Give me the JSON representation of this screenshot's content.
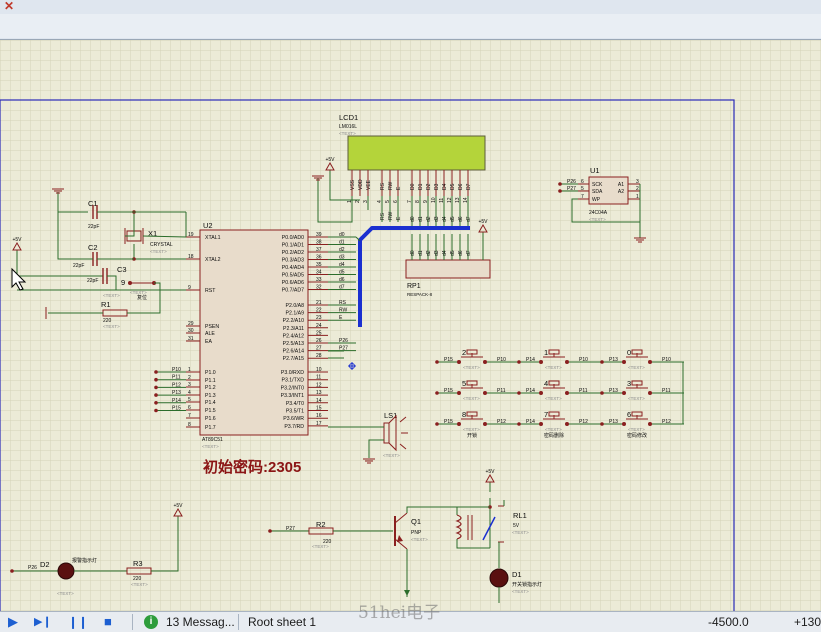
{
  "colors": {
    "canvas_bg": "#ecebd7",
    "grid": "#d5d3b8",
    "sheet_border": "#2a2ab8",
    "wire": "#2b6d2b",
    "component": "#8a1f1f",
    "chip_fill": "#e8dccb",
    "lcd_fill": "#b4d43a",
    "bus": "#1a2fd0",
    "label": "#0b0b0b",
    "text_placeholder": "#8c8c8c",
    "note_red": "#8b1515",
    "pin_dot": "#8a1f1f"
  },
  "icons": {
    "tab_close": "✕",
    "play": "▶",
    "step": "▶❙",
    "pause": "❙❙",
    "stop": "■",
    "message": "i"
  },
  "placeholder": "<TEXT>",
  "power": "+5V",
  "lcd": {
    "ref": "LCD1",
    "part": "LM016L",
    "pins_left": [
      "VSS",
      "VDD",
      "VEE"
    ],
    "pins_ctrl": [
      "RS",
      "RW",
      "E"
    ],
    "pins_data": [
      "D0",
      "D1",
      "D2",
      "D3",
      "D4",
      "D5",
      "D6",
      "D7"
    ],
    "pin_nums": [
      "1",
      "2",
      "3",
      "4",
      "5",
      "6",
      "7",
      "8",
      "9",
      "10",
      "11",
      "12",
      "13",
      "14"
    ]
  },
  "mcu": {
    "ref": "U2",
    "part": "AT89C51",
    "left_pins": [
      {
        "num": "19",
        "name": "XTAL1"
      },
      {
        "num": "18",
        "name": "XTAL2"
      },
      {
        "num": "9",
        "name": "RST"
      },
      {
        "num": "29",
        "name": "PSEN"
      },
      {
        "num": "30",
        "name": "ALE"
      },
      {
        "num": "31",
        "name": "EA"
      },
      {
        "num": "1",
        "name": "P1.0"
      },
      {
        "num": "2",
        "name": "P1.1"
      },
      {
        "num": "3",
        "name": "P1.2"
      },
      {
        "num": "4",
        "name": "P1.3"
      },
      {
        "num": "5",
        "name": "P1.4"
      },
      {
        "num": "6",
        "name": "P1.5"
      },
      {
        "num": "7",
        "name": "P1.6"
      },
      {
        "num": "8",
        "name": "P1.7"
      }
    ],
    "right_p0": [
      {
        "num": "39",
        "name": "P0.0/AD0",
        "net": "d0"
      },
      {
        "num": "38",
        "name": "P0.1/AD1",
        "net": "d1"
      },
      {
        "num": "37",
        "name": "P0.2/AD2",
        "net": "d2"
      },
      {
        "num": "36",
        "name": "P0.3/AD3",
        "net": "d3"
      },
      {
        "num": "35",
        "name": "P0.4/AD4",
        "net": "d4"
      },
      {
        "num": "34",
        "name": "P0.5/AD5",
        "net": "d5"
      },
      {
        "num": "33",
        "name": "P0.6/AD6",
        "net": "d6"
      },
      {
        "num": "32",
        "name": "P0.7/AD7",
        "net": "d7"
      }
    ],
    "right_p2": [
      {
        "num": "21",
        "name": "P2.0/A8",
        "net": "RS"
      },
      {
        "num": "22",
        "name": "P2.1/A9",
        "net": "RW"
      },
      {
        "num": "23",
        "name": "P2.2/A10",
        "net": "E"
      },
      {
        "num": "24",
        "name": "P2.3/A11",
        "net": ""
      },
      {
        "num": "25",
        "name": "P2.4/A12",
        "net": ""
      },
      {
        "num": "26",
        "name": "P2.5/A13",
        "net": "P26"
      },
      {
        "num": "27",
        "name": "P2.6/A14",
        "net": "P27"
      },
      {
        "num": "28",
        "name": "P2.7/A15",
        "net": ""
      }
    ],
    "right_p3": [
      {
        "num": "10",
        "name": "P3.0/RXD"
      },
      {
        "num": "11",
        "name": "P3.1/TXD"
      },
      {
        "num": "12",
        "name": "P3.2/INT0"
      },
      {
        "num": "13",
        "name": "P3.3/INT1"
      },
      {
        "num": "14",
        "name": "P3.4/T0"
      },
      {
        "num": "15",
        "name": "P3.5/T1"
      },
      {
        "num": "16",
        "name": "P3.6/WR"
      },
      {
        "num": "17",
        "name": "P3.7/RD"
      }
    ],
    "p1_nets": [
      "P10",
      "P11",
      "P12",
      "P13",
      "P14",
      "P15"
    ]
  },
  "crystal": {
    "ref": "X1",
    "part": "CRYSTAL"
  },
  "c1": {
    "ref": "C1",
    "value": "22pF"
  },
  "c2": {
    "ref": "C2",
    "value": "22pF"
  },
  "c3": {
    "ref": "C3",
    "value": "22pF"
  },
  "reset": {
    "ref": "9",
    "label": "复位"
  },
  "r1": {
    "ref": "R1",
    "value": "220"
  },
  "rp1": {
    "ref": "RP1",
    "part": "RESPACK-8",
    "pins": [
      "2",
      "3",
      "4",
      "5",
      "6",
      "7",
      "8",
      "9"
    ]
  },
  "eeprom": {
    "ref": "U1",
    "part": "24C04A",
    "pins": [
      "SCK",
      "SDA",
      "WP",
      "A1",
      "A2"
    ],
    "pin_nums_left": [
      "6",
      "5",
      "7"
    ],
    "pin_nums_right": [
      "3",
      "2",
      "1"
    ],
    "nets": [
      "P26",
      "P27"
    ]
  },
  "keypad": {
    "rows": [
      [
        {
          "ref": "2",
          "left": "P15",
          "right": "P10",
          "label": ""
        },
        {
          "ref": "1",
          "left": "P14",
          "right": "P10",
          "label": ""
        },
        {
          "ref": "0",
          "left": "P13",
          "right": "P10",
          "label": ""
        }
      ],
      [
        {
          "ref": "5",
          "left": "P15",
          "right": "P11",
          "label": ""
        },
        {
          "ref": "4",
          "left": "P14",
          "right": "P11",
          "label": ""
        },
        {
          "ref": "3",
          "left": "P13",
          "right": "P11",
          "label": ""
        }
      ],
      [
        {
          "ref": "8",
          "left": "P15",
          "right": "P12",
          "label": "开锁"
        },
        {
          "ref": "7",
          "left": "P14",
          "right": "P12",
          "label": "密码删除"
        },
        {
          "ref": "6",
          "left": "P13",
          "right": "P12",
          "label": "密码修改"
        }
      ]
    ]
  },
  "buzzer": {
    "ref": "LS1"
  },
  "note": "初始密码:2305",
  "d2": {
    "ref": "D2",
    "net": "P26",
    "label": "报警指示灯"
  },
  "r3": {
    "ref": "R3",
    "value": "220"
  },
  "r2": {
    "ref": "R2",
    "value": "220",
    "net": "P27"
  },
  "q1": {
    "ref": "Q1",
    "part": "PNP"
  },
  "relay": {
    "ref": "RL1",
    "value": "5V"
  },
  "d1": {
    "ref": "D1",
    "label": "开关锁指示灯"
  },
  "statusbar": {
    "messages": "13 Messag...",
    "sheet": "Root sheet 1",
    "coord_x": "-4500.0",
    "coord_y": "+1300"
  },
  "watermark": "51hei电子"
}
